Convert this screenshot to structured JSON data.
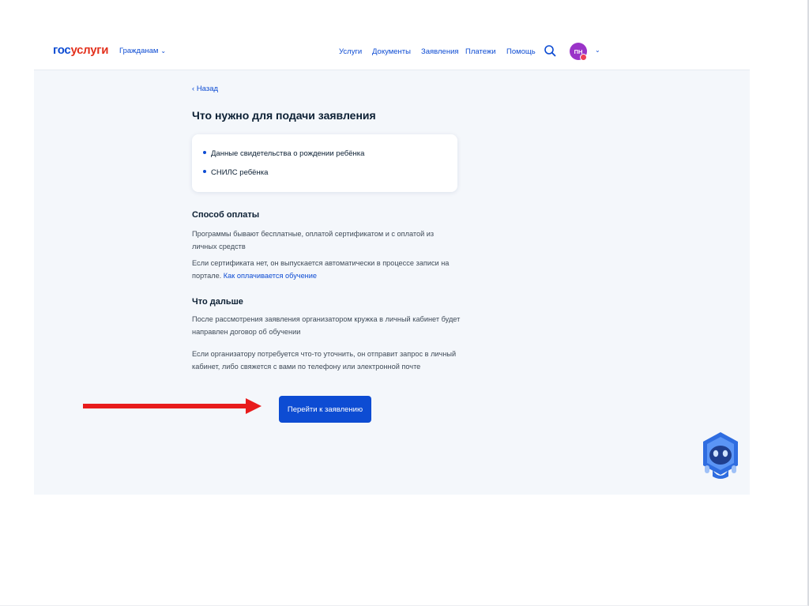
{
  "header": {
    "logo_gos": "гос",
    "logo_uslugi": "услуги",
    "audience_label": "Гражданам",
    "nav": [
      "Услуги",
      "Документы",
      "Заявления",
      "Платежи",
      "Помощь"
    ],
    "avatar_initials": "ПН"
  },
  "main": {
    "back_label": "Назад",
    "title": "Что нужно для подачи заявления",
    "documents": [
      "Данные свидетельства о рождении ребёнка",
      "СНИЛС ребёнка"
    ],
    "payment": {
      "title": "Способ оплаты",
      "para1": "Программы бывают бесплатные, оплатой сертификатом и с оплатой из личных средств",
      "para2_text": "Если сертификата нет, он выпускается автоматически в процессе записи на портале.",
      "para2_link": "Как оплачивается обучение"
    },
    "next": {
      "title": "Что дальше",
      "para1": "После рассмотрения заявления организатором кружка в личный кабинет будет направлен договор об обучении",
      "para2": "Если организатору потребуется что-то уточнить, он отправит запрос в личный кабинет, либо свяжется с вами по телефону или электронной почте"
    },
    "cta_label": "Перейти к заявлению"
  },
  "colors": {
    "brand_blue": "#0d4cd3",
    "brand_red": "#e3311d",
    "avatar": "#9a33c8",
    "arrow": "#e81c1c",
    "page_bg": "#f4f7fb"
  },
  "icons": [
    "search-icon",
    "chevron-down-icon",
    "back-chevron-icon",
    "robot-assistant-icon",
    "arrow-right-icon"
  ]
}
